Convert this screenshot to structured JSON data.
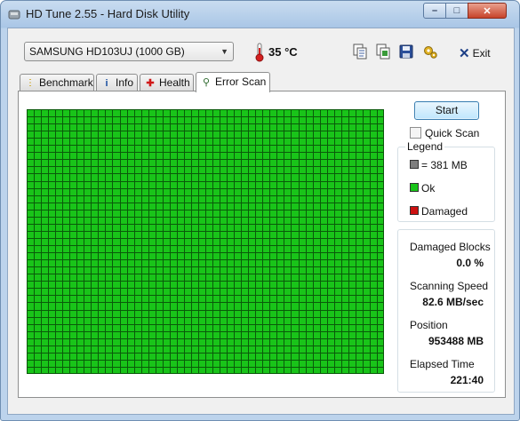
{
  "window": {
    "title": "HD Tune 2.55 - Hard Disk Utility"
  },
  "toolbar": {
    "drive": "SAMSUNG HD103UJ (1000 GB)",
    "temperature": "35 °C",
    "exit_label": "Exit",
    "icons": [
      "copy-info-icon",
      "copy-screenshot-icon",
      "save-icon",
      "options-icon"
    ]
  },
  "tabs": [
    {
      "label": "Benchmark",
      "icon": "benchmark-icon"
    },
    {
      "label": "Info",
      "icon": "info-icon"
    },
    {
      "label": "Health",
      "icon": "health-icon"
    },
    {
      "label": "Error Scan",
      "icon": "error-scan-icon",
      "active": true
    }
  ],
  "scan": {
    "start_label": "Start",
    "quick_scan_label": "Quick Scan",
    "quick_scan_checked": false,
    "block_grid": {
      "columns": 50,
      "rows": 37,
      "ok_color": "#19c419",
      "border_color": "#0a5a0a",
      "status": "ok"
    }
  },
  "legend": {
    "title": "Legend",
    "items": [
      {
        "label": "= 381 MB",
        "color": "#7f7f7f"
      },
      {
        "label": "Ok",
        "color": "#19c419"
      },
      {
        "label": "Damaged",
        "color": "#cc1111"
      }
    ]
  },
  "stats": {
    "damaged_blocks_label": "Damaged Blocks",
    "damaged_blocks_value": "0.0 %",
    "scanning_speed_label": "Scanning Speed",
    "scanning_speed_value": "82.6 MB/sec",
    "position_label": "Position",
    "position_value": "953488 MB",
    "elapsed_time_label": "Elapsed Time",
    "elapsed_time_value": "221:40"
  }
}
